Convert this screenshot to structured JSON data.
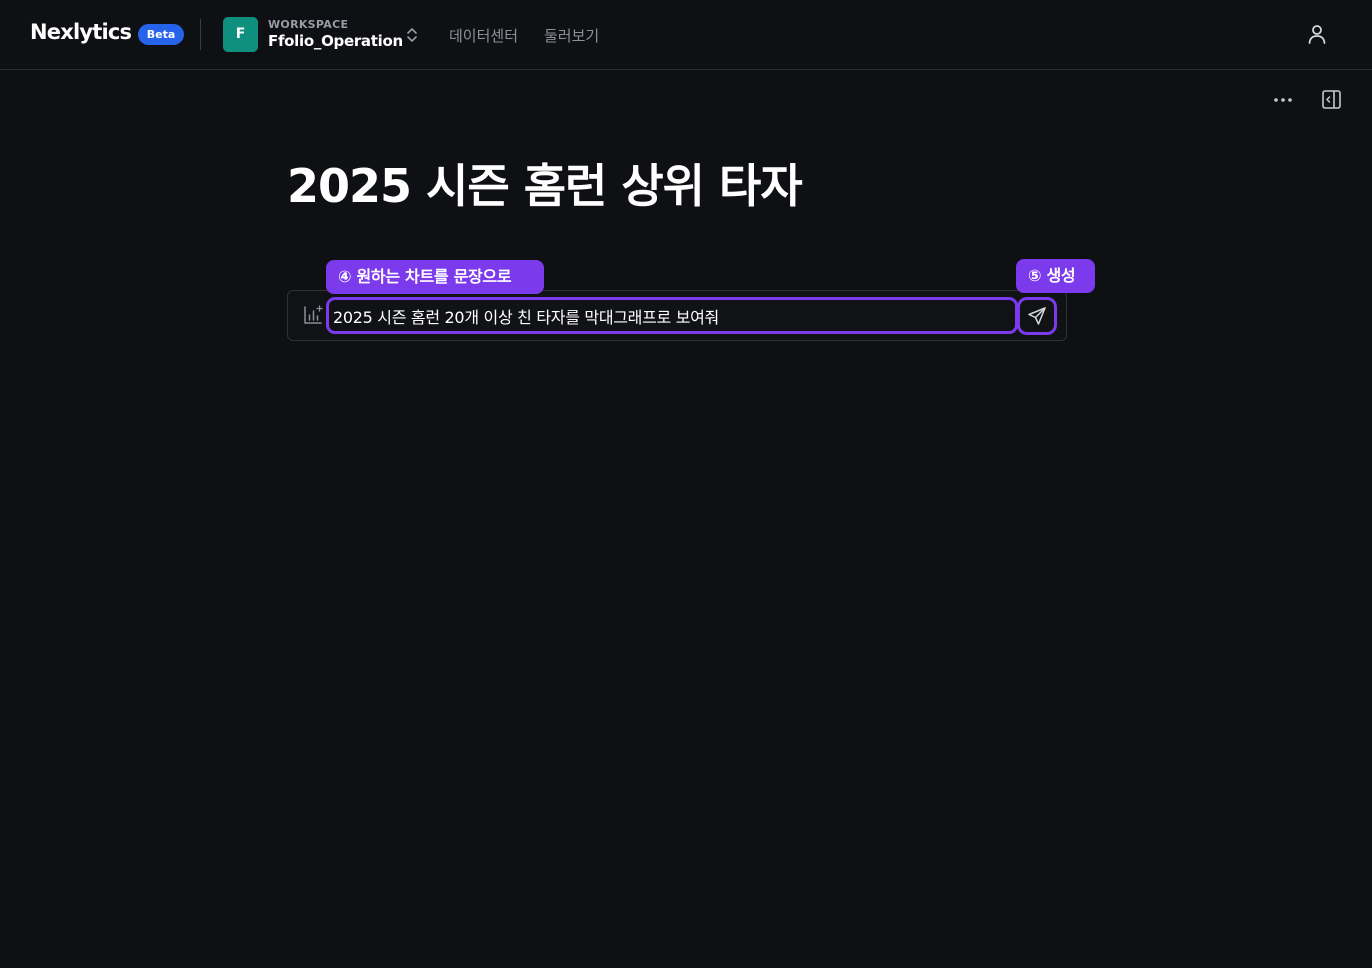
{
  "header": {
    "brand": "Nexlytics",
    "beta_label": "Beta",
    "workspace": {
      "avatar_letter": "F",
      "caption": "WORKSPACE",
      "name": "Ffolio_Operation"
    },
    "nav": [
      {
        "label": "데이터센터"
      },
      {
        "label": "둘러보기"
      }
    ]
  },
  "page": {
    "title": "2025 시즌 홈런 상위 타자"
  },
  "prompt": {
    "value": "2025 시즌 홈런 20개 이상 친 타자를 막대그래프로 보여줘"
  },
  "annotations": {
    "step4": "④ 원하는 차트를 문장으로",
    "step5": "⑤ 생성"
  },
  "colors": {
    "background": "#0f1014",
    "accent": "#7c3aed",
    "beta_badge": "#2563eb",
    "workspace_avatar": "#0f8f7e"
  },
  "icons": [
    "chevron-up-down-icon",
    "user-icon",
    "more-horizontal-icon",
    "panel-collapse-icon",
    "chart-sparkle-icon",
    "send-icon"
  ]
}
